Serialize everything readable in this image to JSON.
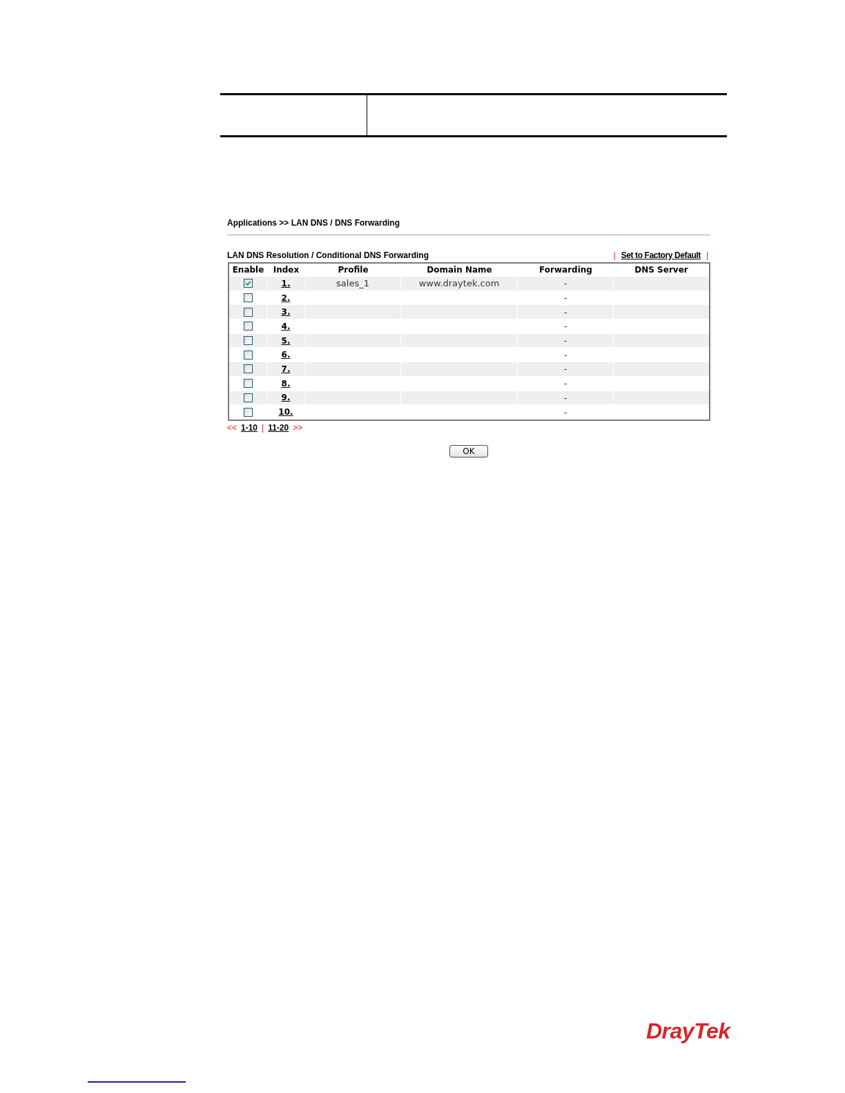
{
  "breadcrumb": "Applications >> LAN DNS / DNS Forwarding",
  "section": {
    "title": "LAN DNS Resolution / Conditional DNS Forwarding",
    "factory_default": {
      "before": "|",
      "label": "Set to Factory Default",
      "after": "|"
    }
  },
  "table": {
    "columns": [
      "Enable",
      "Index",
      "Profile",
      "Domain Name",
      "Forwarding",
      "DNS Server"
    ],
    "rows": [
      {
        "checked": true,
        "index": "1.",
        "profile": "sales_1",
        "domain_name": "www.draytek.com",
        "forwarding": "-"
      },
      {
        "checked": false,
        "index": "2.",
        "forwarding": "-"
      },
      {
        "checked": false,
        "index": "3.",
        "forwarding": "-"
      },
      {
        "checked": false,
        "index": "4.",
        "forwarding": "-"
      },
      {
        "checked": false,
        "index": "5.",
        "forwarding": "-"
      },
      {
        "checked": false,
        "index": "6.",
        "forwarding": "-"
      },
      {
        "checked": false,
        "index": "7.",
        "forwarding": "-"
      },
      {
        "checked": false,
        "index": "8.",
        "forwarding": "-"
      },
      {
        "checked": false,
        "index": "9.",
        "forwarding": "-"
      },
      {
        "checked": false,
        "index": "10.",
        "forwarding": "-"
      }
    ]
  },
  "pagination": {
    "previous": "<<",
    "pages": [
      "1-10",
      "11-20"
    ],
    "separator": "|",
    "next": ">>"
  },
  "ok_button": "OK",
  "logo": "DrayTek"
}
